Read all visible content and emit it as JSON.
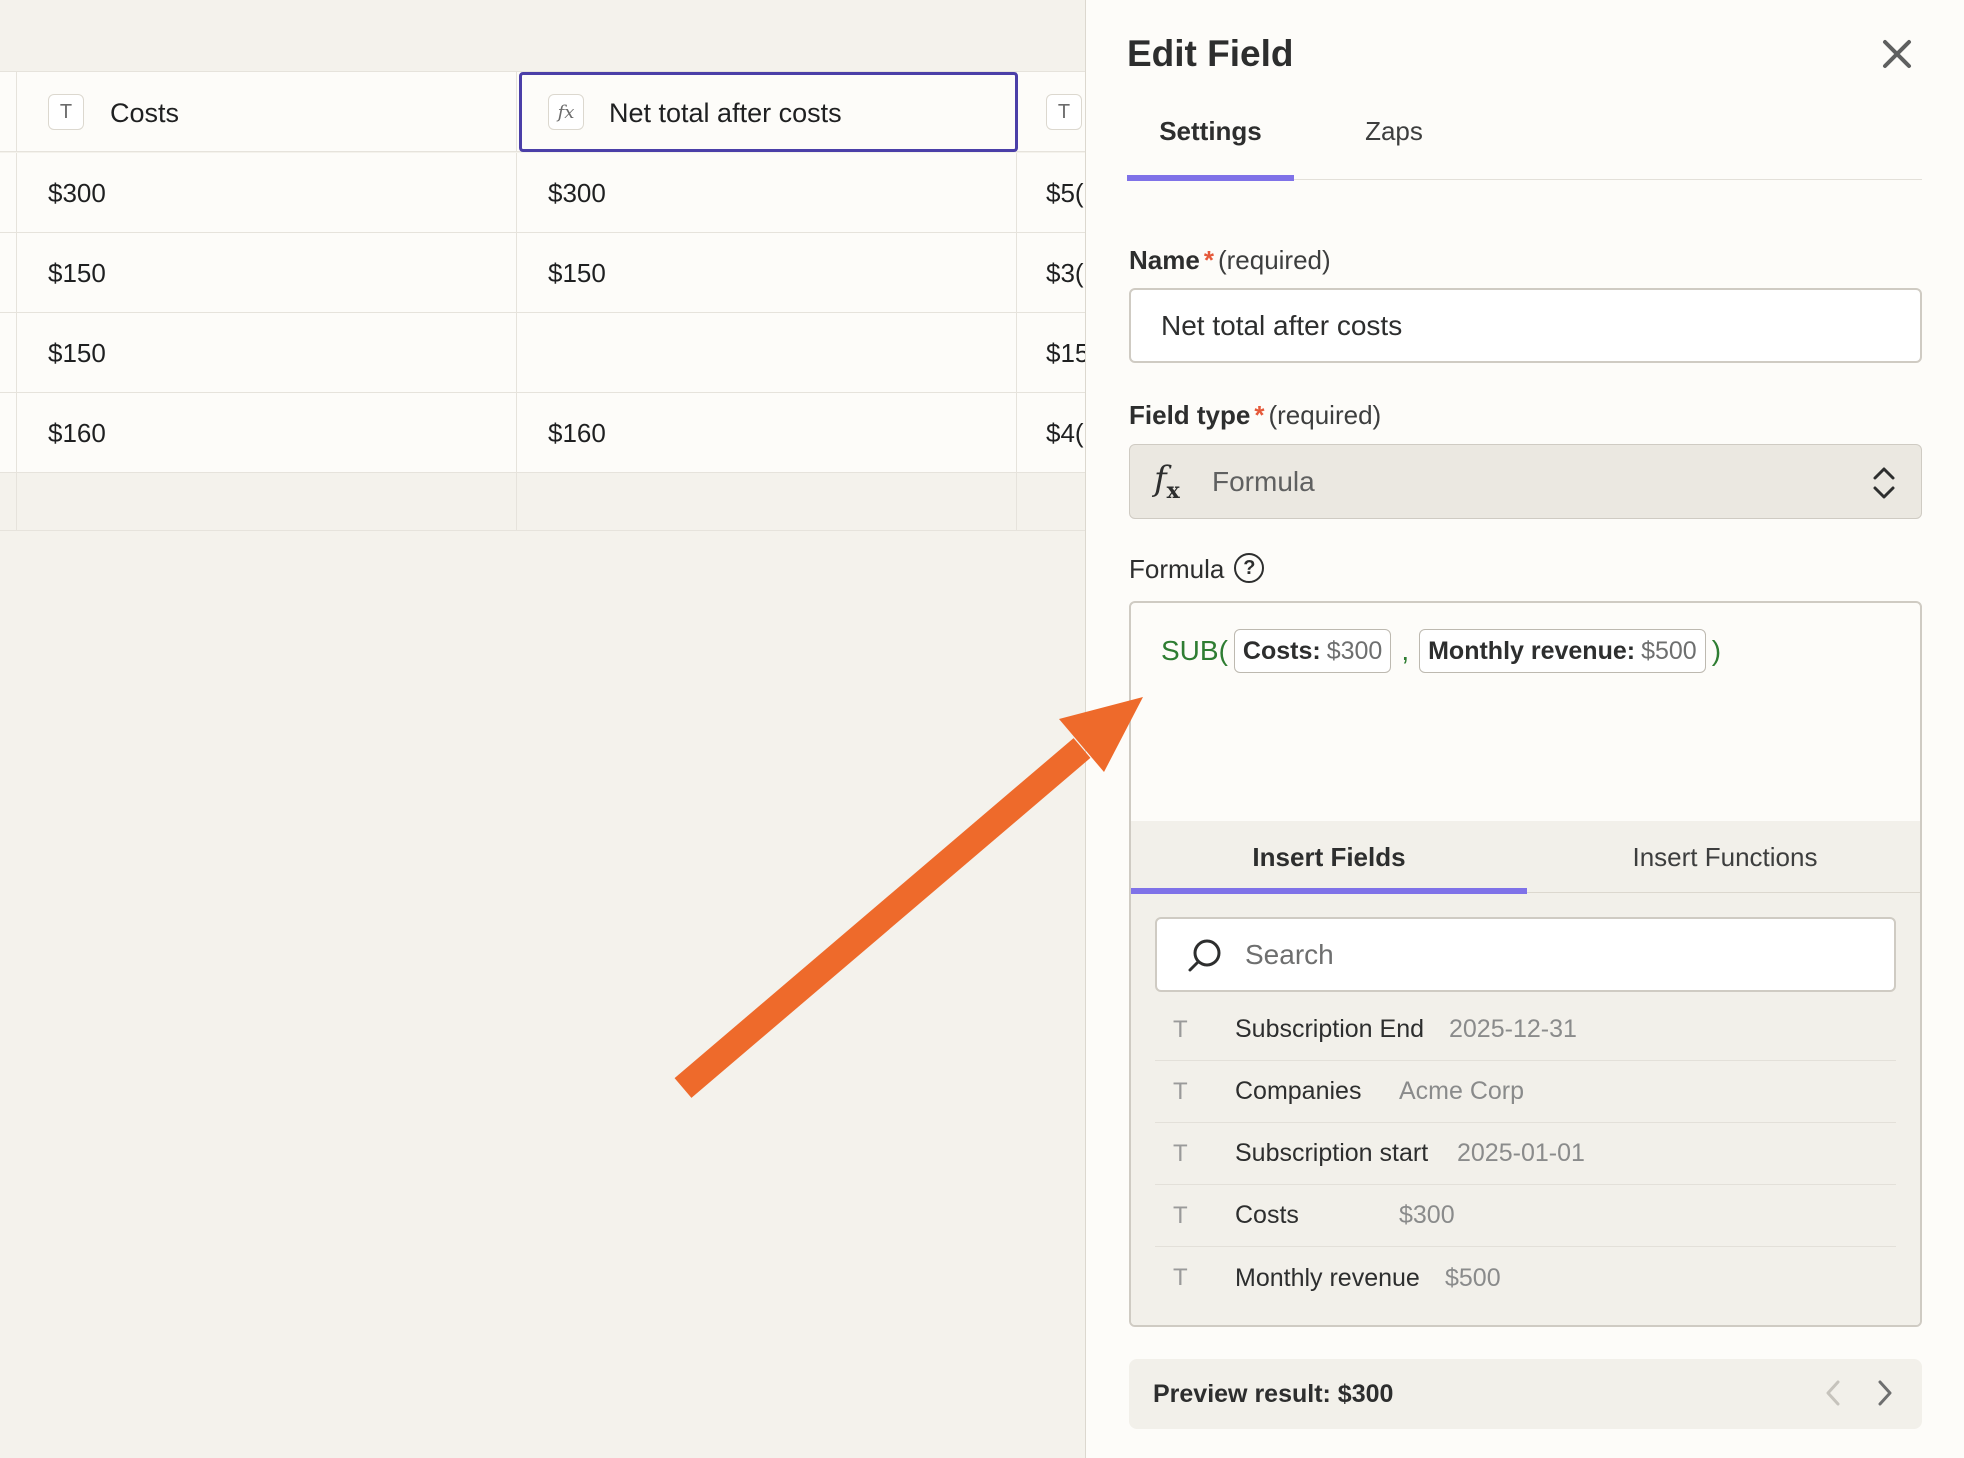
{
  "table": {
    "columns": [
      {
        "type_icon": "T",
        "label": "Costs"
      },
      {
        "type_icon": "fx",
        "label": "Net total after costs"
      },
      {
        "type_icon": "T",
        "label": ""
      }
    ],
    "rows": [
      [
        "$300",
        "$300",
        "$5("
      ],
      [
        "$150",
        "$150",
        "$3("
      ],
      [
        "$150",
        "",
        "$15"
      ],
      [
        "$160",
        "$160",
        "$4("
      ]
    ]
  },
  "panel": {
    "title": "Edit Field",
    "tabs": [
      {
        "label": "Settings",
        "active": true
      },
      {
        "label": "Zaps",
        "active": false
      }
    ],
    "name_field": {
      "label": "Name",
      "required_mark": "*",
      "required_text": "(required)",
      "value": "Net total after costs"
    },
    "type_field": {
      "label": "Field type",
      "required_mark": "*",
      "required_text": "(required)",
      "value": "Formula",
      "icon": "function-icon"
    },
    "formula": {
      "label": "Formula",
      "function": "SUB(",
      "arg1_name": "Costs:",
      "arg1_value": "$300",
      "separator": ",",
      "arg2_name": "Monthly revenue:",
      "arg2_value": "$500",
      "close": ")"
    },
    "insert_tabs": [
      {
        "label": "Insert Fields",
        "active": true
      },
      {
        "label": "Insert Functions",
        "active": false
      }
    ],
    "search": {
      "placeholder": "Search"
    },
    "fields": [
      {
        "name": "Subscription End",
        "value": "2025-12-31"
      },
      {
        "name": "Companies",
        "value": "Acme Corp"
      },
      {
        "name": "Subscription start",
        "value": "2025-01-01"
      },
      {
        "name": "Costs",
        "value": "$300"
      },
      {
        "name": "Monthly revenue",
        "value": "$500"
      }
    ],
    "preview": {
      "label": "Preview result: $300"
    }
  },
  "colors": {
    "accent": "#7f72e8",
    "selected_border": "#4b3fa8",
    "arrow": "#ee6a2b",
    "formula_fn": "#2e7d32",
    "required": "#e5593a"
  }
}
